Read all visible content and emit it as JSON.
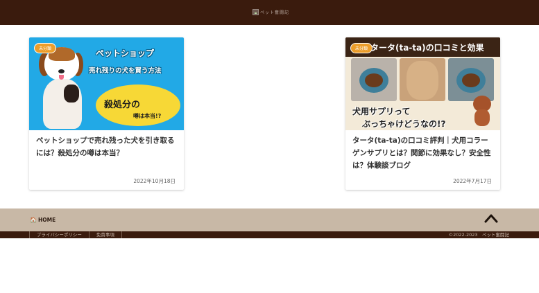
{
  "header": {
    "logo_alt": "ペット奮闘記"
  },
  "posts": [
    {
      "category": "未分類",
      "title": "ペットショップで売れ残った犬を引き取るには？殺処分の噂は本当？",
      "date": "2022年10月18日",
      "thumb": {
        "line1": "ペットショップ",
        "line2": "売れ残りの犬を買う方法",
        "bubble1": "殺処分の",
        "bubble2": "噂は本当!?"
      }
    },
    {
      "category": "未分類",
      "title": "タータ(ta-ta)の口コミ評判｜犬用コラーゲンサプリとは？関節に効果なし？安全性は？体験談ブログ",
      "date": "2022年7月17日",
      "thumb": {
        "line1": "タータ(ta-ta)の口コミと効果",
        "line2": "犬用サプリって",
        "line3": "ぶっちゃけどうなの!?"
      }
    }
  ],
  "footer": {
    "home_label": "HOME",
    "links": [
      "プライバシーポリシー",
      "免責事項"
    ],
    "copyright": "©2022-2023　ペット奮闘記"
  },
  "colors": {
    "brand_dark": "#3a1b0d",
    "footer_band": "#c8b8a6",
    "badge": "#ec9d2a"
  }
}
